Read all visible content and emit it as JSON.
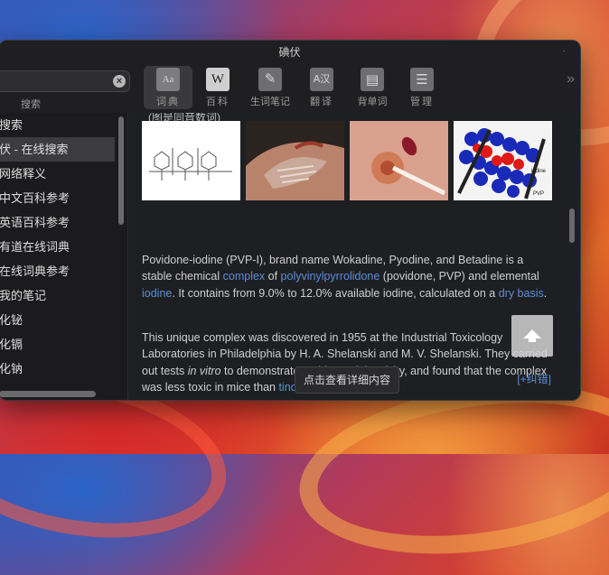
{
  "window": {
    "title": "碘伏"
  },
  "search": {
    "label": "搜索",
    "value": ""
  },
  "toolbar": {
    "tools": [
      {
        "label": "词典",
        "icon": "dictionary-icon",
        "glyph": "Aa",
        "active": true
      },
      {
        "label": "百科",
        "icon": "wikipedia-icon",
        "glyph": "W",
        "active": false
      },
      {
        "label": "生词笔记",
        "icon": "notebook-icon",
        "glyph": "✎",
        "active": false
      },
      {
        "label": "翻译",
        "icon": "translate-icon",
        "glyph": "A汉",
        "active": false
      },
      {
        "label": "背单词",
        "icon": "flashcard-book-icon",
        "glyph": "▤",
        "active": false
      },
      {
        "label": "管理",
        "icon": "manage-cabinet-icon",
        "glyph": "☰",
        "active": false
      }
    ]
  },
  "sidebar": {
    "items": [
      {
        "label": "搜索",
        "active": false
      },
      {
        "label": "伏 - 在线搜索",
        "active": true
      },
      {
        "label": "网络释义",
        "active": false
      },
      {
        "label": "中文百科参考",
        "active": false
      },
      {
        "label": "英语百科参考",
        "active": false
      },
      {
        "label": "有道在线词典",
        "active": false
      },
      {
        "label": "在线词典参考",
        "active": false
      },
      {
        "label": "我的笔记",
        "active": false
      },
      {
        "label": "化铋",
        "active": false
      },
      {
        "label": "化镉",
        "active": false
      },
      {
        "label": "化钠",
        "active": false
      }
    ]
  },
  "content": {
    "cut_heading": "(图是同音数词)",
    "para1": {
      "t1": "Povidone-iodine (PVP-I), brand name Wokadine, Pyodine, and Betadine is a stable chemical ",
      "l1": "complex",
      "t2": " of ",
      "l2": "polyvinylpyrrolidone",
      "t3": " (povidone, PVP) and elemental ",
      "l3": "iodine",
      "t4": ". It contains from 9.0% to 12.0% available iodine, calculated on a ",
      "l4": "dry basis",
      "t5": "."
    },
    "para2": {
      "t1": "This unique complex was discovered in 1955 at the Industrial Toxicology Laboratories in Philadelphia by H. A. Shelanski and M. V. Shelanski. They carried out tests ",
      "em": "in vitro",
      "t2": " to demonstrate anti-bacterial activity, and found that the complex was less toxic in mice than ",
      "l1": "tincture of iodine",
      "t3": "."
    },
    "detail_button": "点击查看详细内容",
    "correct_link": "[+纠错]",
    "pvp_label": "PVP",
    "iodine_label": "iodine"
  }
}
